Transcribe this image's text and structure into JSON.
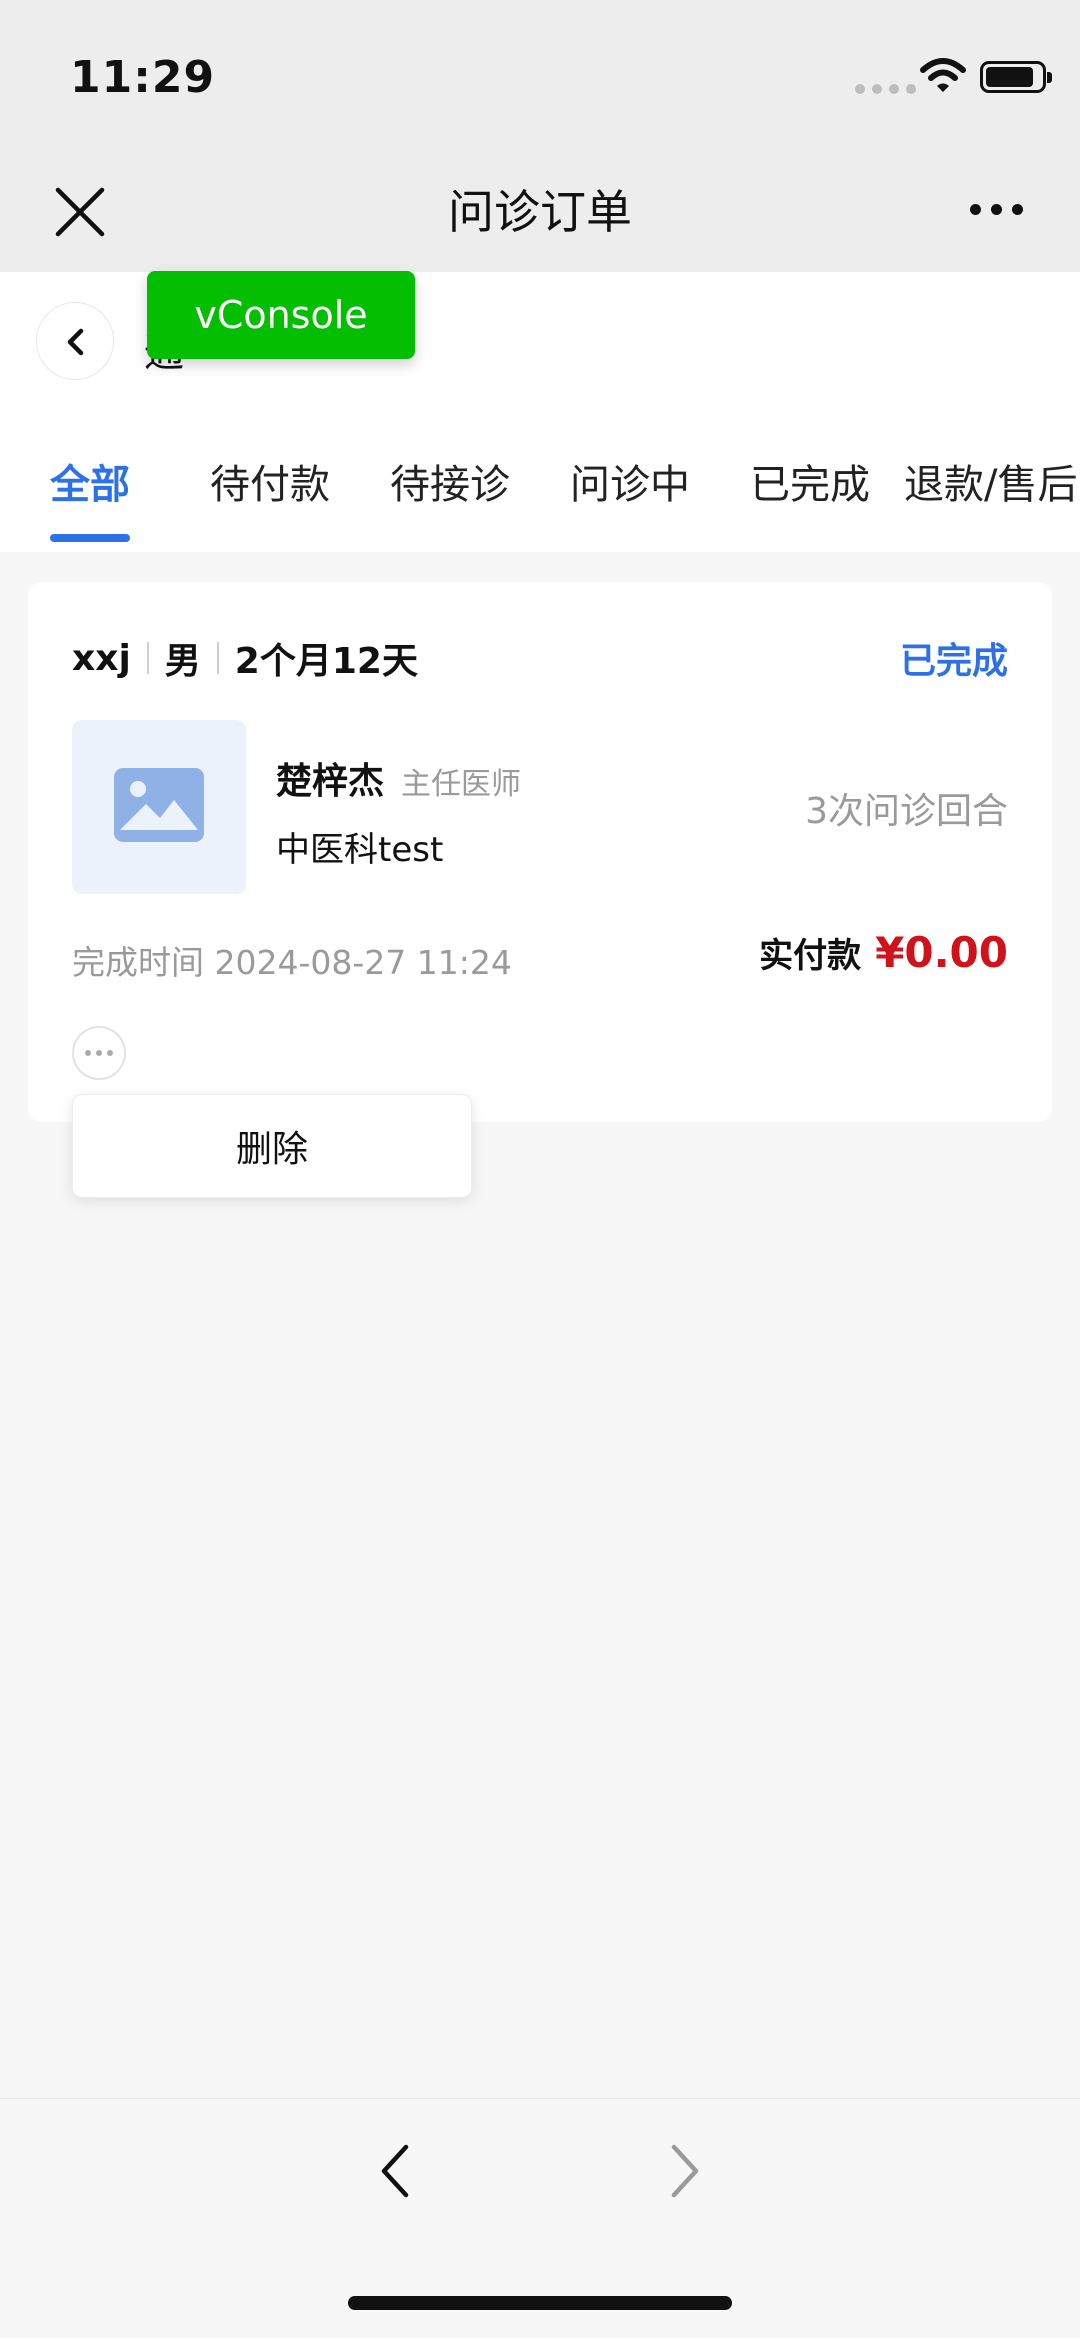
{
  "status_bar": {
    "time": "11:29",
    "icons": [
      "cellular-dots-icon",
      "wifi-icon",
      "battery-icon"
    ]
  },
  "title_bar": {
    "title": "问诊订单",
    "left_icon": "close-icon",
    "right_icon": "more-icon"
  },
  "header": {
    "back_icon": "chevron-left-icon",
    "behind_text": "通",
    "vconsole_label": "vConsole"
  },
  "tabs": [
    {
      "label": "全部",
      "active": true
    },
    {
      "label": "待付款",
      "active": false
    },
    {
      "label": "待接诊",
      "active": false
    },
    {
      "label": "问诊中",
      "active": false
    },
    {
      "label": "已完成",
      "active": false
    },
    {
      "label": "退款/售后",
      "active": false
    }
  ],
  "colors": {
    "accent": "#2c72e6",
    "price": "#d0121b",
    "vconsole": "#04be02"
  },
  "order": {
    "patient_name": "xxj",
    "patient_gender": "男",
    "patient_age": "2个月12天",
    "status": "已完成",
    "doctor_name": "楚梓杰",
    "doctor_title": "主任医师",
    "department": "中医科test",
    "rounds": "3次问诊回合",
    "finish_time": "完成时间 2024-08-27 11:24",
    "paid_label": "实付款",
    "paid_amount": "¥0.00",
    "image_icon": "image-placeholder-icon",
    "more_button_icon": "ellipsis-icon"
  },
  "popup_menu": {
    "items": [
      "删除"
    ]
  },
  "bottom_nav": {
    "back_icon": "chevron-left-icon",
    "forward_icon": "chevron-right-icon"
  }
}
